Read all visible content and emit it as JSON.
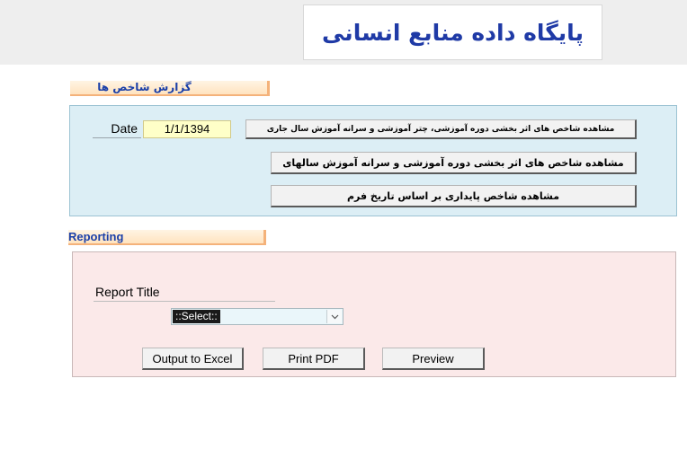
{
  "header": {
    "title": "پایگاه داده منابع انسانی"
  },
  "indicators_section": {
    "title": "گزارش شاخص ها",
    "date_label": "Date",
    "date_value": "1/1/1394",
    "buttons": [
      {
        "label": "مشاهده شاخص های اثر بخشی دوره آموزشی، چتر آموزشی و سرانه آموزش سال جاری"
      },
      {
        "label": "مشاهده شاخص های اثر بخشی دوره آموزشی و سرانه آموزش سالهای"
      },
      {
        "label": "مشاهده شاخص پایداری بر اساس تاریخ فرم"
      }
    ]
  },
  "reporting_section": {
    "title": "Reporting",
    "report_title_label": "Report Title",
    "select_value": "::Select::",
    "buttons": {
      "excel": "Output to Excel",
      "pdf": "Print PDF",
      "preview": "Preview"
    }
  },
  "colors": {
    "title_blue": "#1f3aa6",
    "panel_blue_bg": "#dceef5",
    "panel_pink_bg": "#fbe9e9",
    "date_input_bg": "#ffffc8",
    "tab_accent": "#f4b27a"
  }
}
